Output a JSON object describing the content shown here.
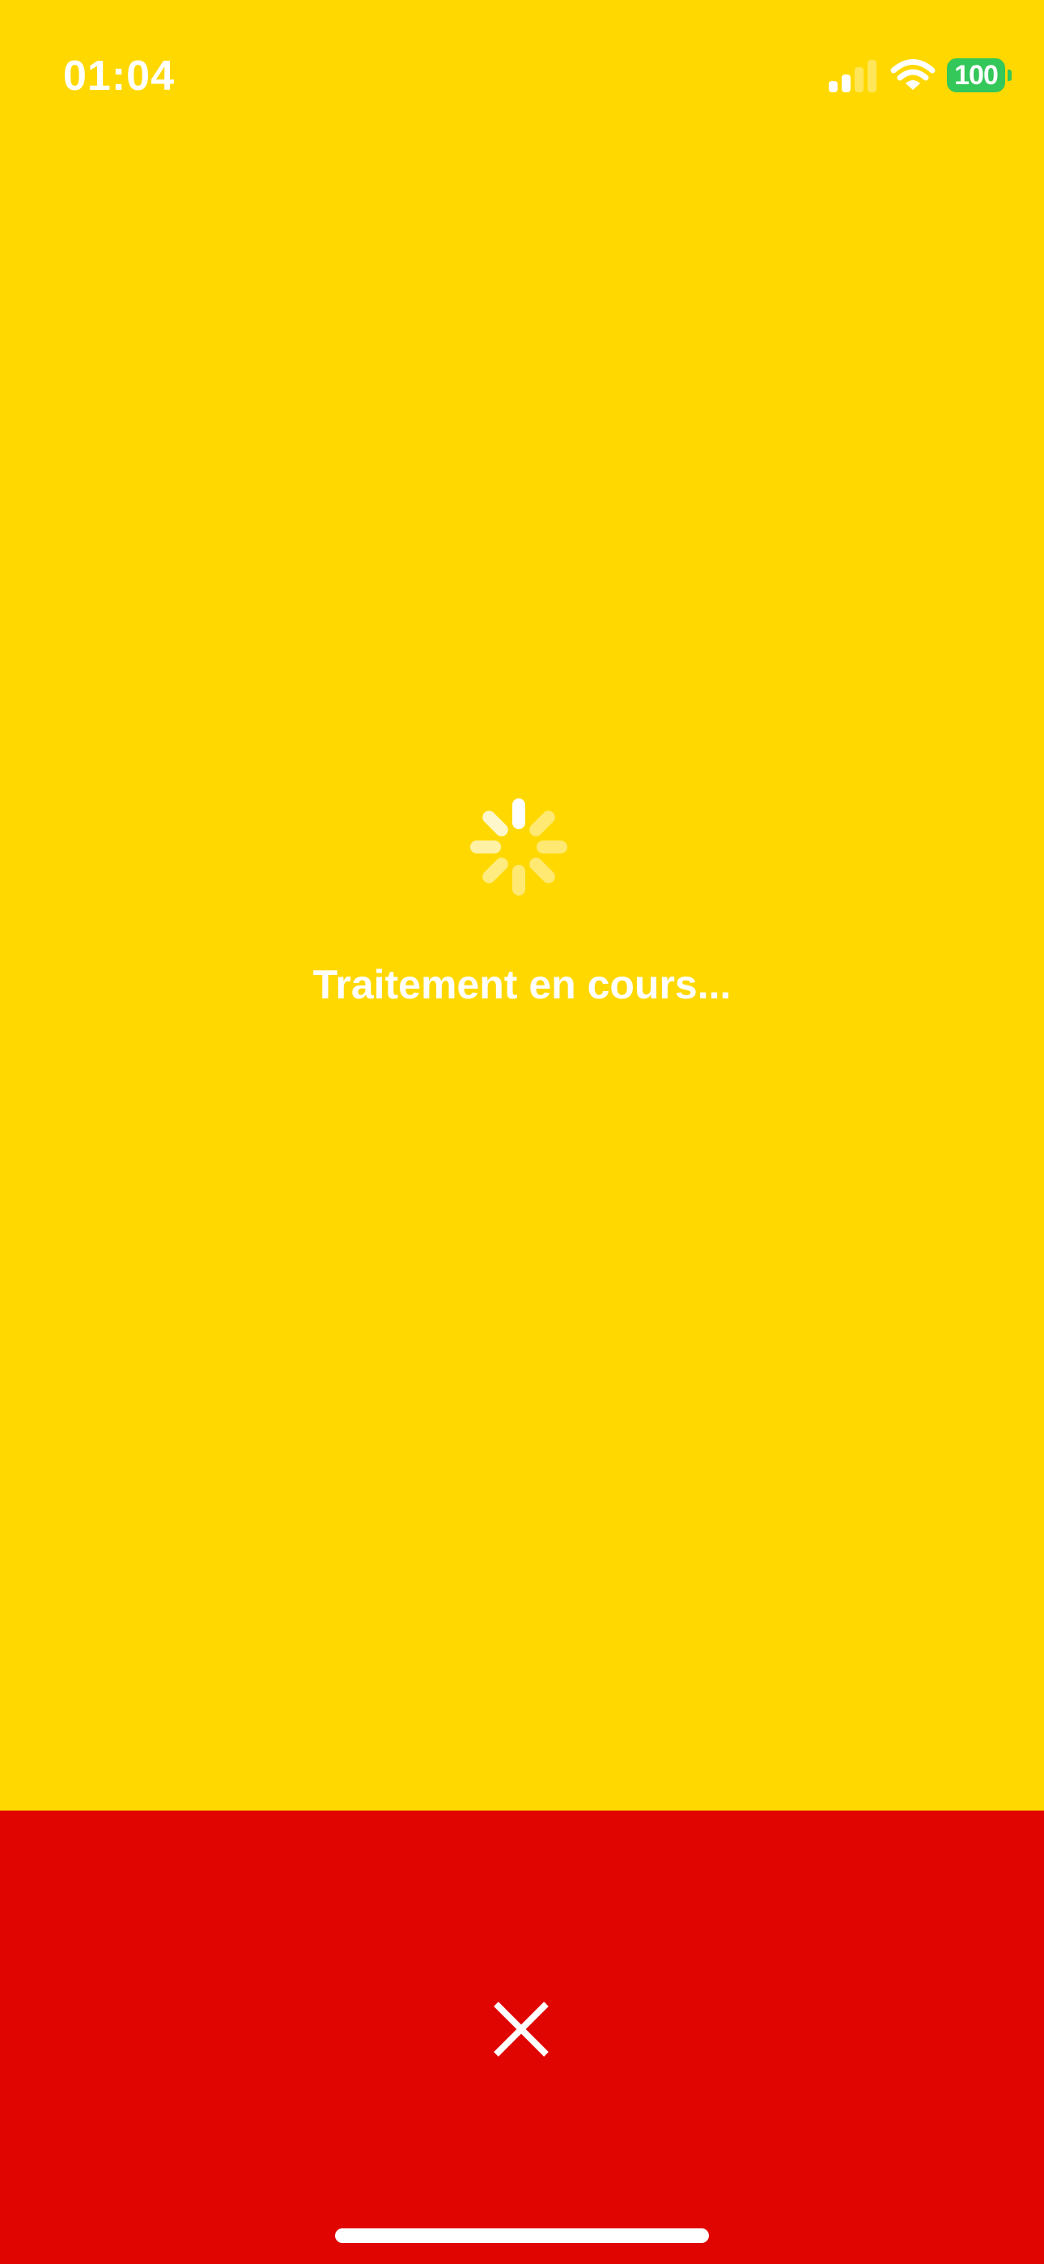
{
  "status_bar": {
    "time": "01:04",
    "battery_level": "100",
    "signal_icon": "cellular-signal-icon",
    "wifi_icon": "wifi-icon",
    "battery_icon": "battery-icon"
  },
  "loading": {
    "spinner_icon": "loading-spinner-icon",
    "message": "Traitement en cours..."
  },
  "bottom_bar": {
    "close_icon": "close-icon"
  },
  "colors": {
    "background": "#FFD800",
    "bottom_bar": "#E00500",
    "battery": "#34C759",
    "text": "#FFFFFF"
  }
}
